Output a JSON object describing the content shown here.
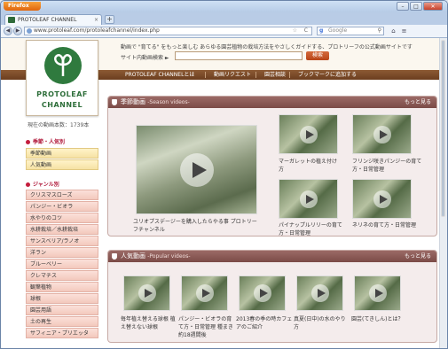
{
  "browser": {
    "app_button": "Firefox",
    "tab_title": "PROTOLEAF CHANNEL",
    "url": "www.protoleaf.com/protoleafchannel/index.php",
    "search_placeholder": "Google",
    "min_icon": "–",
    "max_icon": "□",
    "close_icon": "✕",
    "new_tab_icon": "+",
    "tab_close_icon": "×",
    "back_icon": "◀",
    "forward_icon": "▶",
    "star_icon": "☆",
    "reload_icon": "C",
    "g_icon": "g",
    "search_icon": "⚲",
    "home_icon": "⌂",
    "bookmark_icon": "≡"
  },
  "site": {
    "tagline": "動画で \"育てる\" をもっと楽しむ あらゆる園芸植物の栽培方法をやさしくガイドする、プロトリーフの公式動画サイトです",
    "search_label": "サイト内動画検索 ►",
    "search_button": "検索",
    "logo_line1": "PROTOLEAF",
    "logo_line2": "CHANNEL",
    "menu": [
      "PROTOLEAF CHANNELとは",
      "動画リクエスト",
      "園芸相談",
      "ブックマークに追加する"
    ]
  },
  "sidebar": {
    "counter": "現在の動画本数：1739本",
    "season_heading": "季節・人気別",
    "season_items": [
      "季節動画",
      "人気動画"
    ],
    "genre_heading": "ジャンル別",
    "genre_items": [
      "クリスマスローズ",
      "パンジー・ビオラ",
      "水やりのコツ",
      "水耕栽培／水耕栽培",
      "サンスベリア/ラノオ",
      "洋ラン",
      "ブルーベリー",
      "クレマチス",
      "観葉植物",
      "球根",
      "園芸用語",
      "土の再生",
      "サフィニア・プリエッタ"
    ]
  },
  "seasonal": {
    "title": "季節動画",
    "subtitle": "-Season videos-",
    "more": "もっと見る",
    "featured_caption": "ユリオプスデージーを購入したらやる事 プロトリーフチャンネル",
    "items": [
      {
        "caption": "マーガレットの植え付け方"
      },
      {
        "caption": "フリンジ咲きパンジーの育て方・日常管理"
      },
      {
        "caption": "パイナップルリリーの育て方・日常管理"
      },
      {
        "caption": "ネリネの育て方・日常管理"
      }
    ]
  },
  "popular": {
    "title": "人気動画",
    "subtitle": "-Popular videos-",
    "more": "もっと見る",
    "items": [
      {
        "caption": "毎年植え替える球根 植え替えない球根"
      },
      {
        "caption": "パンジー・ビオラの育て方・日常管理 種まき 約18週間後"
      },
      {
        "caption": "2013春の季の時カフェアのご紹介"
      },
      {
        "caption": "真夏(日中)の水のやり方"
      },
      {
        "caption": "園芸(てきしん)とは？"
      }
    ]
  }
}
